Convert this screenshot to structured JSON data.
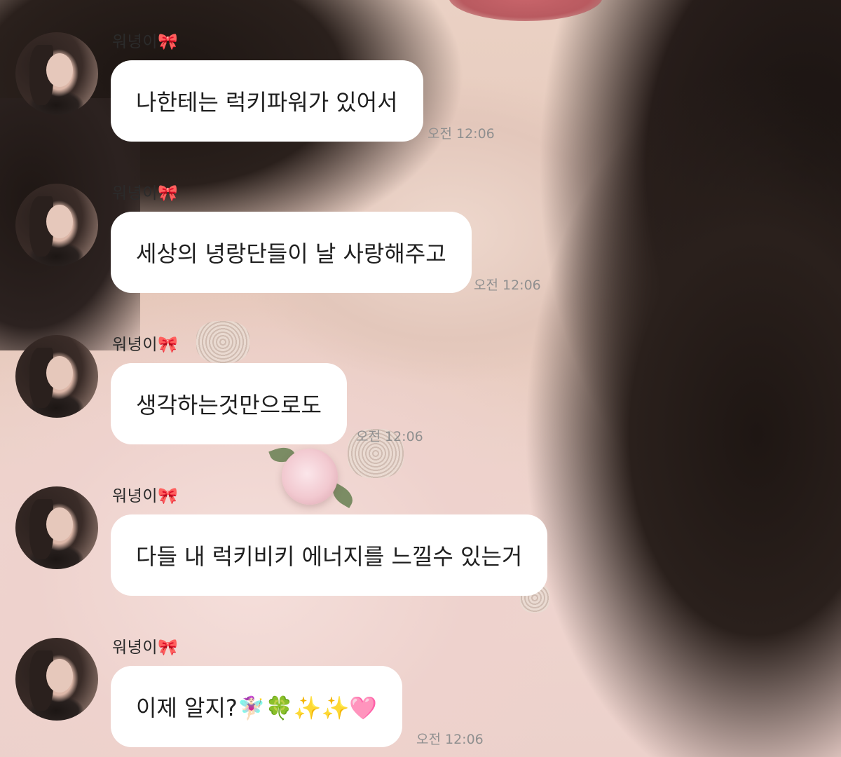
{
  "sender": {
    "name": "워녕이🎀"
  },
  "messages": [
    {
      "text": "나한테는 럭키파워가 있어서",
      "time": "오전 12:06"
    },
    {
      "text": "세상의 녕랑단들이 날 사랑해주고",
      "time": "오전 12:06"
    },
    {
      "text": "생각하는것만으로도",
      "time": "오전 12:06"
    },
    {
      "text": "다들 내 럭키비키 에너지를 느낄수 있는거",
      "time": ""
    },
    {
      "text": "이제 알지?🧚🏻‍♀️🍀✨✨🩷",
      "time": "오전 12:06"
    }
  ],
  "colors": {
    "bubble": "#ffffff",
    "time": "#8f8f8f",
    "name": "#2b2b2b"
  }
}
